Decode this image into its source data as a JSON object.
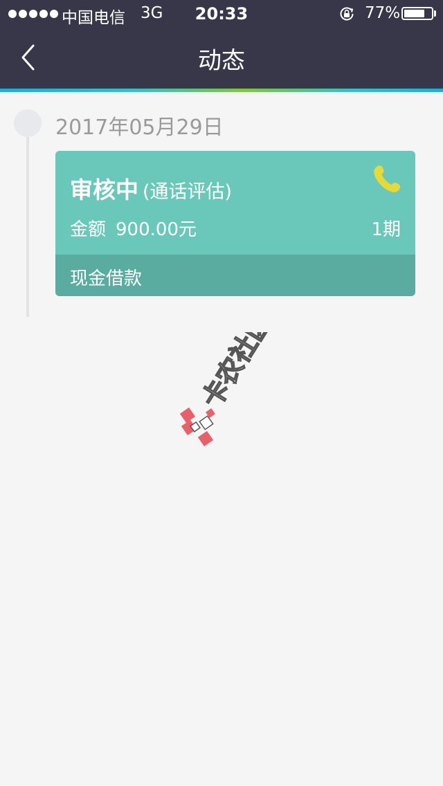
{
  "status_bar": {
    "carrier": "中国电信",
    "network": "3G",
    "time": "20:33",
    "battery_percent": "77%",
    "battery_level": 0.77
  },
  "nav": {
    "title": "动态",
    "back_icon": "chevron-left-icon"
  },
  "timeline": [
    {
      "date": "2017年05月29日",
      "card": {
        "status": "审核中",
        "status_detail": "(通话评估)",
        "amount_label": "金额",
        "amount_value": "900.00元",
        "term": "1期",
        "product": "现金借款",
        "icon": "phone-icon"
      }
    }
  ],
  "watermark": {
    "text": "卡农社区",
    "icon": "gift-box-icon"
  },
  "colors": {
    "header_bg": "#383649",
    "page_bg": "#f5f5f5",
    "card_bg": "#6ac8ba",
    "card_footer_bg": "#5aaca0",
    "phone_icon": "#e6d93a"
  }
}
